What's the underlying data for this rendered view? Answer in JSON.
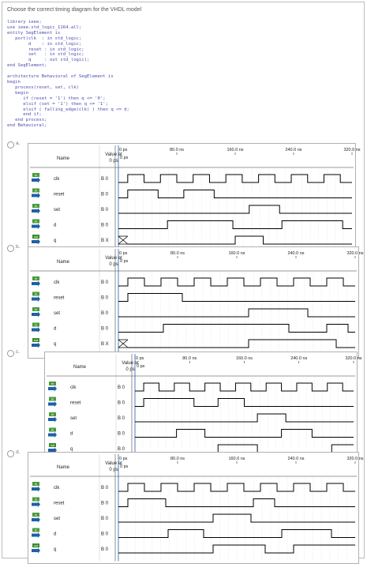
{
  "question": "Choose the correct timing diagram for the VHDL model",
  "code_lines": [
    "library ieee;",
    "use ieee.std_logic_1164.all;",
    "entity SegElement is",
    "   port(clk  : in std_logic;",
    "        d    : in std_logic;",
    "        reset : in std_logic;",
    "        set   : in std_logic;",
    "        q     : out std_logic);",
    "end SegElement;",
    "",
    "architecture Behavioral of SegElement is",
    "begin",
    "   process(reset, set, clk)",
    "   begin",
    "      if (reset = '1') then q <= '0';",
    "      elsif (set = '1') then q <= '1';",
    "      elsif ( falling_edge(clk) ) then q <= d;",
    "      end if;",
    "   end process;",
    "end Behavioral;"
  ],
  "table": {
    "name_header": "Name",
    "value_header": "Value at",
    "value_subheader": "0 ps",
    "time_labels": [
      "0 ps",
      "80.0 ns",
      "160.0 ns",
      "240.0 ns",
      "320.0 ns"
    ],
    "time_marker": "0 ps"
  },
  "options": [
    {
      "letter": "a.",
      "signals": [
        {
          "dir": "in",
          "name": "clk",
          "value": "B 0"
        },
        {
          "dir": "in",
          "name": "reset",
          "value": "B 0"
        },
        {
          "dir": "in",
          "name": "set",
          "value": "B 0"
        },
        {
          "dir": "in",
          "name": "d",
          "value": "B 0"
        },
        {
          "dir": "out",
          "name": "q",
          "value": "B X"
        }
      ],
      "waves": {
        "clk": {
          "init": 0,
          "toggles": [
            0.04,
            0.11,
            0.18,
            0.25,
            0.32,
            0.39,
            0.46,
            0.53,
            0.6,
            0.67,
            0.74,
            0.81,
            0.88,
            0.95
          ]
        },
        "reset": {
          "init": 0,
          "toggles": [
            0.04,
            0.17,
            0.28,
            0.41
          ]
        },
        "set": {
          "init": 0,
          "toggles": [
            0.56,
            0.69
          ]
        },
        "d": {
          "init": 0,
          "toggles": [
            0.21,
            0.49,
            0.7,
            0.96
          ]
        },
        "q": {
          "init": "X",
          "xuntil": 0.04,
          "toggles": [
            0.5,
            0.62
          ]
        }
      }
    },
    {
      "letter": "b.",
      "signals": [
        {
          "dir": "in",
          "name": "clk",
          "value": "B 0"
        },
        {
          "dir": "in",
          "name": "reset",
          "value": "B 0"
        },
        {
          "dir": "in",
          "name": "set",
          "value": "B 0"
        },
        {
          "dir": "in",
          "name": "d",
          "value": "B 0"
        },
        {
          "dir": "out",
          "name": "q",
          "value": "B X"
        }
      ],
      "waves": {
        "clk": {
          "init": 0,
          "toggles": [
            0.04,
            0.11,
            0.18,
            0.25,
            0.32,
            0.39,
            0.46,
            0.53,
            0.6,
            0.67,
            0.74,
            0.81,
            0.88,
            0.95
          ]
        },
        "reset": {
          "init": 0,
          "toggles": [
            0.04,
            0.27
          ]
        },
        "set": {
          "init": 0,
          "toggles": [
            0.55,
            0.8
          ]
        },
        "d": {
          "init": 0,
          "toggles": [
            0.19,
            0.72,
            0.88,
            0.97
          ]
        },
        "q": {
          "init": "X",
          "xuntil": 0.04,
          "toggles": [
            0.55,
            0.92
          ]
        }
      }
    },
    {
      "letter": "c.",
      "signals": [
        {
          "dir": "in",
          "name": "clk",
          "value": "B 0"
        },
        {
          "dir": "in",
          "name": "reset",
          "value": "B 0"
        },
        {
          "dir": "in",
          "name": "set",
          "value": "B 0"
        },
        {
          "dir": "in",
          "name": "d",
          "value": "B 0"
        },
        {
          "dir": "out",
          "name": "q",
          "value": "B 0"
        }
      ],
      "waves": {
        "clk": {
          "init": 0,
          "toggles": [
            0.04,
            0.11,
            0.18,
            0.25,
            0.32,
            0.39,
            0.46,
            0.53,
            0.6,
            0.67,
            0.74,
            0.81,
            0.88,
            0.95
          ]
        },
        "reset": {
          "init": 0,
          "toggles": [
            0.04,
            0.27,
            0.38,
            0.5
          ]
        },
        "set": {
          "init": 0,
          "toggles": [
            0.56,
            0.69
          ]
        },
        "d": {
          "init": 0,
          "toggles": [
            0.19,
            0.32,
            0.67,
            0.81
          ]
        },
        "q": {
          "init": 0,
          "toggles": [
            0.38,
            0.56,
            0.9
          ]
        }
      }
    },
    {
      "letter": "d.",
      "signals": [
        {
          "dir": "in",
          "name": "clk",
          "value": "B 0"
        },
        {
          "dir": "in",
          "name": "reset",
          "value": "B 0"
        },
        {
          "dir": "in",
          "name": "set",
          "value": "B 0"
        },
        {
          "dir": "in",
          "name": "d",
          "value": "B 0"
        },
        {
          "dir": "out",
          "name": "q",
          "value": "B 0"
        }
      ],
      "waves": {
        "clk": {
          "init": 0,
          "toggles": [
            0.04,
            0.11,
            0.18,
            0.25,
            0.32,
            0.39,
            0.46,
            0.53,
            0.6,
            0.67,
            0.74,
            0.81,
            0.88,
            0.95
          ]
        },
        "reset": {
          "init": 0,
          "toggles": [
            0.04,
            0.2,
            0.57,
            0.66
          ]
        },
        "set": {
          "init": 0,
          "toggles": [
            0.4,
            0.56
          ]
        },
        "d": {
          "init": 0,
          "toggles": [
            0.21,
            0.36,
            0.69,
            0.9
          ]
        },
        "q": {
          "init": 0,
          "toggles": [
            0.4,
            0.62,
            0.74
          ]
        }
      }
    }
  ],
  "colors": {
    "code": "#4d4db0",
    "wave": "#000000",
    "grid": "#c8c8c8",
    "dir_in": "#4a9a3a",
    "dir_out": "#3a8a2a",
    "arrow": "#1f5fa8"
  }
}
